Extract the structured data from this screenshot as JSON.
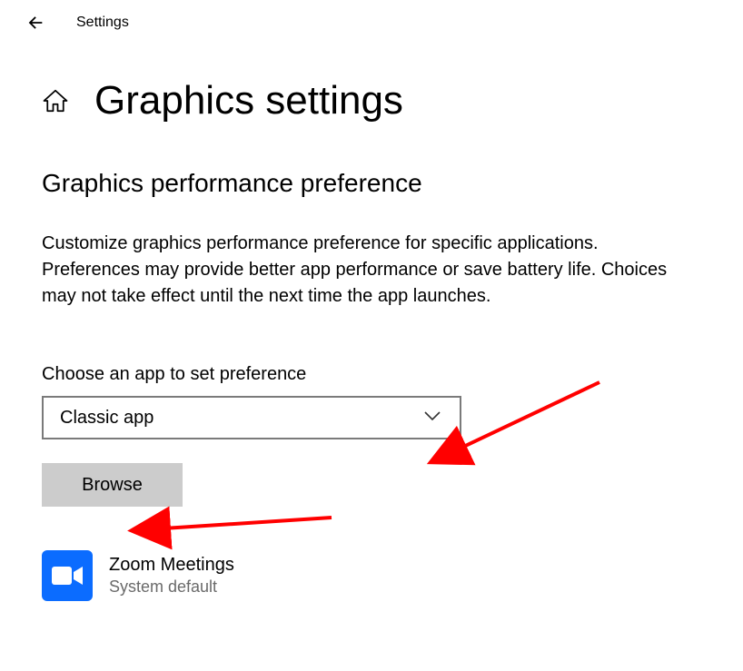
{
  "topbar": {
    "settings_label": "Settings"
  },
  "header": {
    "title": "Graphics settings"
  },
  "main": {
    "section_title": "Graphics performance preference",
    "description": "Customize graphics performance preference for specific applications. Preferences may provide better app performance or save battery life. Choices may not take effect until the next time the app launches.",
    "choose_label": "Choose an app to set preference",
    "dropdown_value": "Classic app",
    "browse_label": "Browse",
    "app": {
      "name": "Zoom Meetings",
      "subtitle": "System default"
    }
  }
}
